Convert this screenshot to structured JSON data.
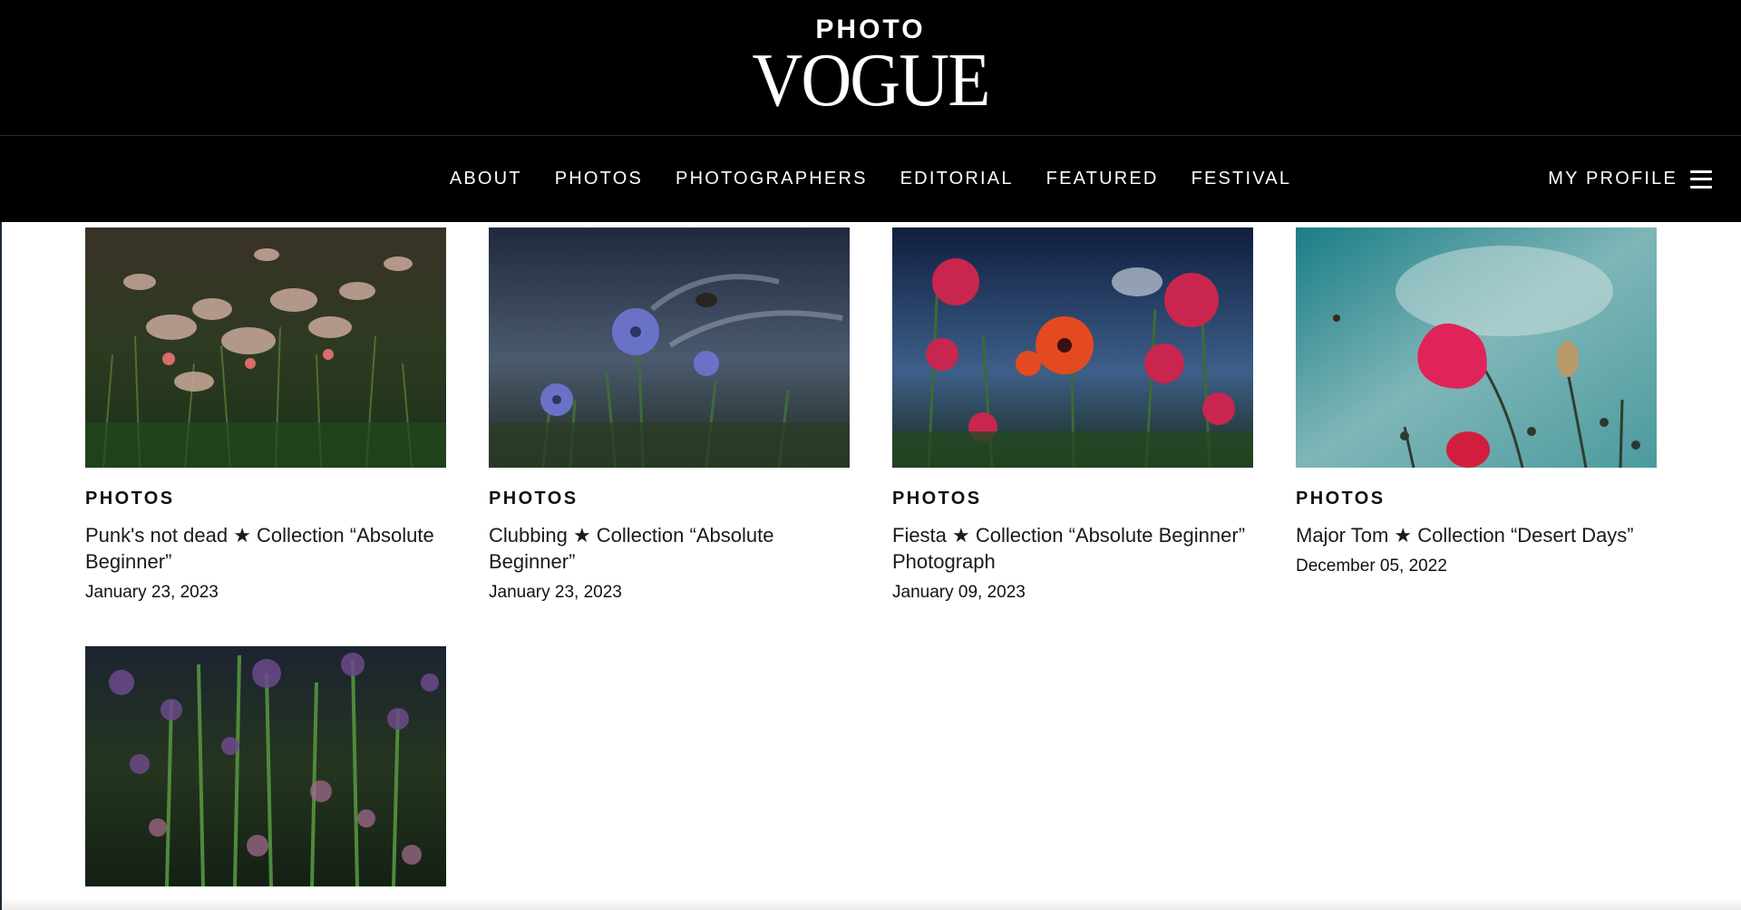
{
  "brand": {
    "kicker": "PHOTO",
    "name": "VOGUE"
  },
  "nav": {
    "items": [
      "ABOUT",
      "PHOTOS",
      "PHOTOGRAPHERS",
      "EDITORIAL",
      "FEATURED",
      "FESTIVAL"
    ],
    "profile_label": "MY PROFILE",
    "menu_icon": "hamburger-icon"
  },
  "cards": [
    {
      "category": "PHOTOS",
      "title": "Punk's not dead ★ Collection “Absolute Beginner”",
      "date": "January 23, 2023"
    },
    {
      "category": "PHOTOS",
      "title": "Clubbing ★ Collection “Absolute Beginner”",
      "date": "January 23, 2023"
    },
    {
      "category": "PHOTOS",
      "title": "Fiesta ★ Collection “Absolute Beginner” Photograph",
      "date": "January 09, 2023"
    },
    {
      "category": "PHOTOS",
      "title": "Major Tom ★ Collection “Desert Days”",
      "date": "December 05, 2022"
    },
    {
      "category": "",
      "title": "",
      "date": ""
    }
  ],
  "colors": {
    "header_bg": "#000000",
    "page_bg": "#ffffff",
    "text": "#111111"
  }
}
